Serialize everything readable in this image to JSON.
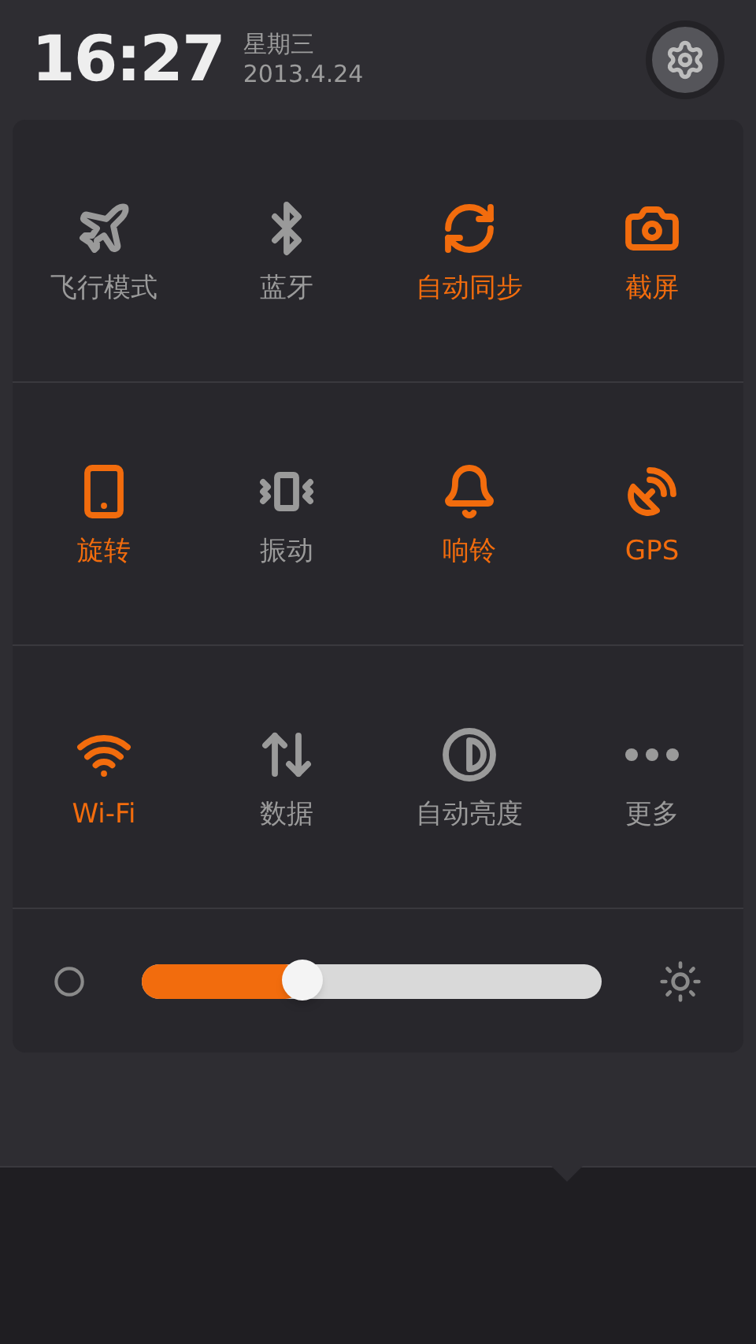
{
  "header": {
    "time": "16:27",
    "weekday": "星期三",
    "date": "2013.4.24"
  },
  "toggles": [
    {
      "kind": "airplane",
      "label": "飞行模式",
      "on": false
    },
    {
      "kind": "bluetooth",
      "label": "蓝牙",
      "on": false
    },
    {
      "kind": "sync",
      "label": "自动同步",
      "on": true
    },
    {
      "kind": "screenshot",
      "label": "截屏",
      "on": true
    },
    {
      "kind": "rotate",
      "label": "旋转",
      "on": true
    },
    {
      "kind": "vibrate",
      "label": "振动",
      "on": false
    },
    {
      "kind": "ring",
      "label": "响铃",
      "on": true
    },
    {
      "kind": "gps",
      "label": "GPS",
      "on": true
    },
    {
      "kind": "wifi",
      "label": "Wi-Fi",
      "on": true
    },
    {
      "kind": "data",
      "label": "数据",
      "on": false
    },
    {
      "kind": "auto_brightness",
      "label": "自动亮度",
      "on": false
    },
    {
      "kind": "more",
      "label": "更多",
      "on": false
    }
  ],
  "brightness": {
    "level": 0.35
  }
}
